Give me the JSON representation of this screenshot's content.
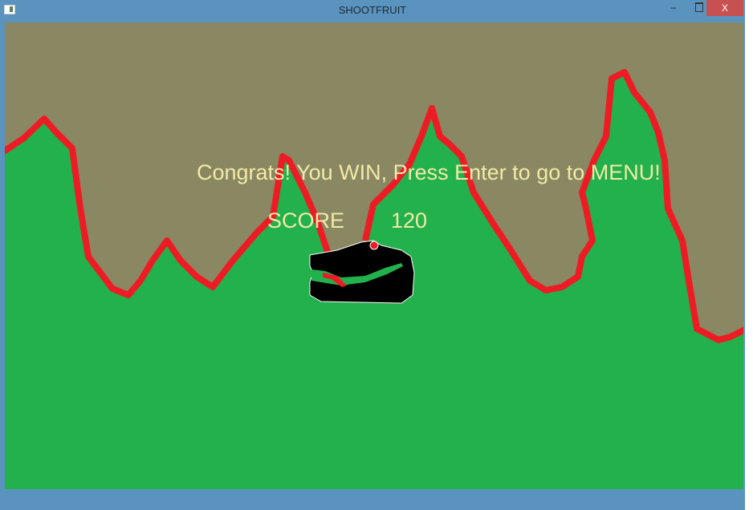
{
  "window": {
    "title": "SHOOTFRUIT",
    "minimize": "–",
    "close": "X"
  },
  "game": {
    "message": "Congrats! You WIN, Press Enter to go to MENU!",
    "score_label": "SCORE",
    "score_value": "120",
    "colors": {
      "sky": "#8a8763",
      "ground": "#22b14c",
      "outline": "#ed1c24",
      "text": "#f2eaa6"
    }
  }
}
